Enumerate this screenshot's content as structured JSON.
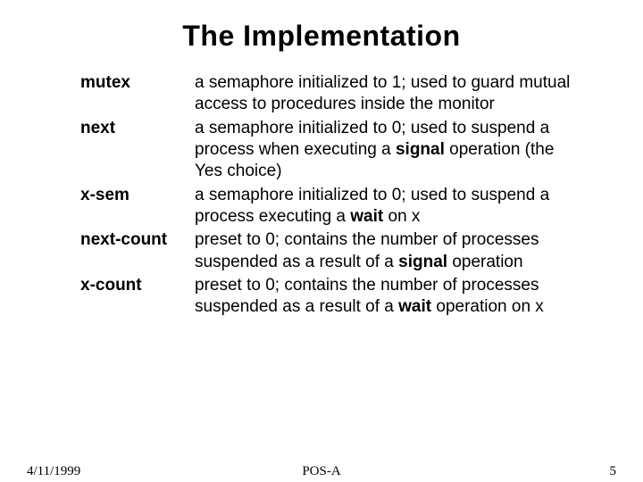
{
  "title": "The Implementation",
  "rows": [
    {
      "term": "mutex",
      "desc": "a semaphore initialized to 1; used to guard mutual access to procedures inside the monitor"
    },
    {
      "term": "next",
      "desc_pre": "a semaphore initialized to 0; used to suspend a process when executing a ",
      "desc_bold": "signal",
      "desc_post": " operation (the Yes choice)"
    },
    {
      "term": "x-sem",
      "desc_pre": "a semaphore initialized to 0; used to suspend a process executing a ",
      "desc_bold": "wait",
      "desc_post": " on x"
    },
    {
      "term": "next-count",
      "desc_pre": "preset to 0; contains the number of processes suspended as a result of a ",
      "desc_bold": "signal",
      "desc_post": " operation"
    },
    {
      "term": "x-count",
      "desc_pre": "preset to 0; contains the number of processes suspended as a result of a ",
      "desc_bold": "wait",
      "desc_post": " operation on x"
    }
  ],
  "footer": {
    "date": "4/11/1999",
    "center": "POS-A",
    "page": "5"
  }
}
